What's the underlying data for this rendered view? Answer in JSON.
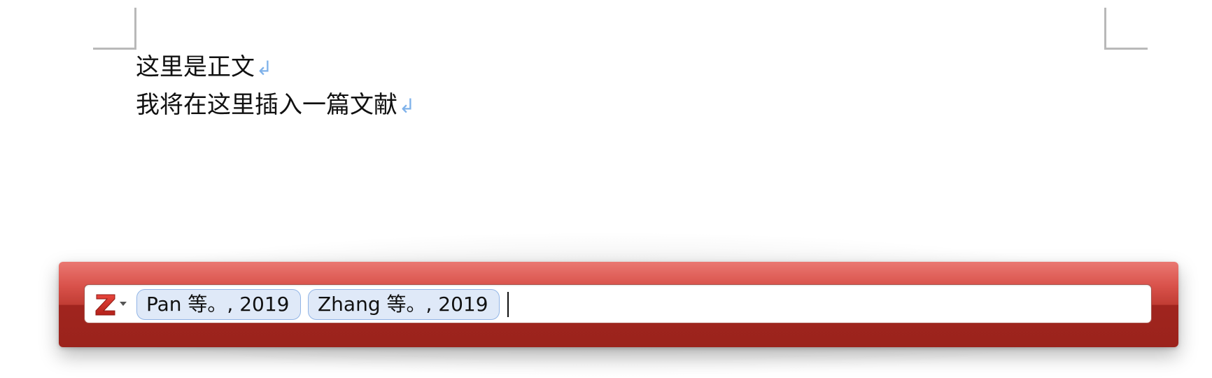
{
  "document": {
    "lines": [
      {
        "text": "这里是正文",
        "mark": "↲"
      },
      {
        "text": "我将在这里插入一篇文献",
        "mark": "↲"
      }
    ]
  },
  "quick_format": {
    "menu_icon": "zotero-z-icon",
    "citations": [
      {
        "label": "Pan 等。, 2019"
      },
      {
        "label": "Zhang 等。, 2019"
      }
    ],
    "input_value": ""
  },
  "colors": {
    "bar_top": "#ea7872",
    "bar_bottom": "#9b231c",
    "bubble_bg": "#dfe9f8",
    "bubble_border": "#92b5e6",
    "paragraph_mark": "#7fb2ea",
    "crop_mark": "#b9b9b9"
  }
}
